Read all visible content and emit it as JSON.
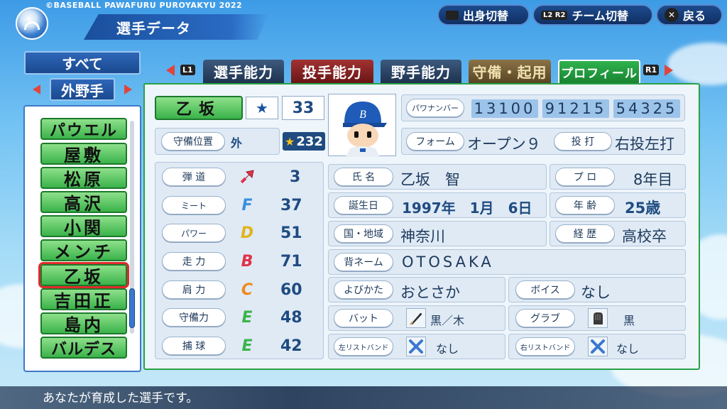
{
  "header": {
    "game_tag": "©BASEBALL PAWAFURU PUROYAKYU 2022",
    "title": "選手データ",
    "buttons": [
      {
        "key": "",
        "label": "出身切替"
      },
      {
        "key": "L2 R2",
        "label": "チーム切替"
      },
      {
        "key": "✕",
        "label": "戻る"
      }
    ]
  },
  "left": {
    "filter_all": "すべて",
    "position_filter": "外野手",
    "players": [
      "パウエル",
      "屋敷",
      "松原",
      "高沢",
      "小関",
      "メンチ",
      "乙坂",
      "吉田正",
      "島内",
      "バルデス"
    ],
    "selected_index": 6
  },
  "tabs": {
    "left_key": "L1",
    "right_key": "R1",
    "items": [
      "選手能力",
      "投手能力",
      "野手能力",
      "守備・起用",
      "プロフィール"
    ],
    "active_index": 4
  },
  "profile": {
    "name": "乙坂",
    "team_logo": "★",
    "number": "33",
    "position_label": "守備位置",
    "position_value": "外",
    "star_value": "232",
    "pawanumber_label": "パワナンバー",
    "pawanumbers": [
      "13100",
      "91215",
      "54325"
    ],
    "form_label": "フォーム",
    "form_value": "オープン９",
    "throw_bat_label": "投 打",
    "throw_bat_value": "右投左打"
  },
  "abilities": [
    {
      "label": "弾 道",
      "grade": "",
      "value": "3",
      "icon": "trajectory-arrow-icon"
    },
    {
      "label": "ミート",
      "grade": "F",
      "value": "37",
      "color": "#3a8fe0"
    },
    {
      "label": "パワー",
      "grade": "D",
      "value": "51",
      "color": "#e0b51a"
    },
    {
      "label": "走 力",
      "grade": "B",
      "value": "71",
      "color": "#e0324a"
    },
    {
      "label": "肩 力",
      "grade": "C",
      "value": "60",
      "color": "#f08a1e"
    },
    {
      "label": "守備力",
      "grade": "E",
      "value": "48",
      "color": "#3ab34a"
    },
    {
      "label": "捕 球",
      "grade": "E",
      "value": "42",
      "color": "#3ab34a"
    }
  ],
  "details": {
    "fullname_label": "氏 名",
    "fullname": "乙坂　智",
    "pro_label": "プ ロ",
    "pro_value": "8年目",
    "birthday_label": "誕生日",
    "birthday": "1997年　1月　6日",
    "age_label": "年 齢",
    "age_value": "25歳",
    "region_label": "国・地域",
    "region": "神奈川",
    "career_label": "経 歴",
    "career": "高校卒",
    "backname_label": "背ネーム",
    "backname": "OTOSAKA",
    "reading_label": "よびかた",
    "reading": "おとさか",
    "voice_label": "ボイス",
    "voice": "なし",
    "bat_label": "バット",
    "bat": "黒／木",
    "glove_label": "グラブ",
    "glove": "黒",
    "lwb_label": "左リストバンド",
    "lwb": "なし",
    "rwb_label": "右リストバンド",
    "rwb": "なし"
  },
  "footer": {
    "message": "あなたが育成した選手です。"
  }
}
